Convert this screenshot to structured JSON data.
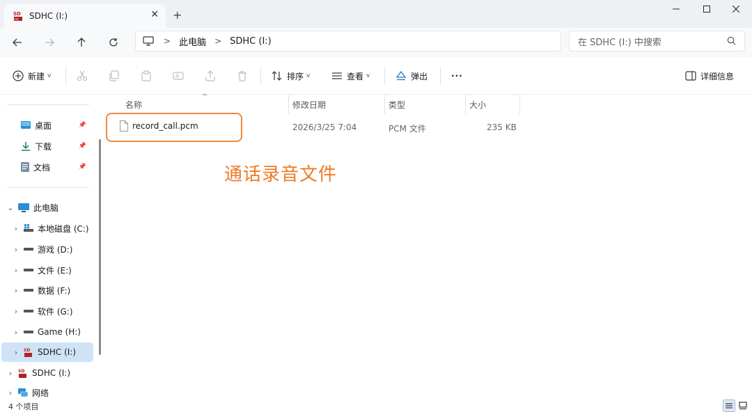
{
  "tab": {
    "title": "SDHC (I:)",
    "close": "✕",
    "new_tab": "+"
  },
  "window_controls": {
    "minimize": "—",
    "maximize": "☐",
    "close": "✕"
  },
  "address": {
    "crumbs": [
      "此电脑",
      "SDHC (I:)"
    ],
    "search_placeholder": "在 SDHC (I:) 中搜索"
  },
  "toolbar": {
    "new_label": "新建",
    "sort_label": "排序",
    "view_label": "查看",
    "eject_label": "弹出",
    "more_label": "···",
    "details_label": "详细信息"
  },
  "sidebar": {
    "quick_access": [
      {
        "label": "桌面",
        "icon": "desktop-icon"
      },
      {
        "label": "下载",
        "icon": "download-icon"
      },
      {
        "label": "文档",
        "icon": "document-icon"
      }
    ],
    "this_pc": "此电脑",
    "drives": [
      {
        "label": "本地磁盘 (C:)",
        "icon": "system-drive-icon"
      },
      {
        "label": "游戏 (D:)",
        "icon": "drive-icon"
      },
      {
        "label": "文件 (E:)",
        "icon": "drive-icon"
      },
      {
        "label": "数据 (F:)",
        "icon": "drive-icon"
      },
      {
        "label": "软件 (G:)",
        "icon": "drive-icon"
      },
      {
        "label": "Game (H:)",
        "icon": "drive-icon"
      },
      {
        "label": "SDHC (I:)",
        "icon": "sd-card-icon"
      }
    ],
    "extra": [
      {
        "label": "SDHC (I:)",
        "icon": "sd-card-icon"
      },
      {
        "label": "网络",
        "icon": "network-icon"
      }
    ]
  },
  "columns": {
    "name": "名称",
    "modified": "修改日期",
    "type": "类型",
    "size": "大小"
  },
  "files": [
    {
      "name": "record_call.pcm",
      "modified": "2026/3/25 7:04",
      "type": "PCM 文件",
      "size": "235 KB"
    }
  ],
  "annotation": "通话录音文件",
  "status": {
    "item_count": "4 个项目"
  },
  "colors": {
    "highlight": "#f0883e",
    "annotation": "#f07a26",
    "selected": "#cfe3f7"
  }
}
